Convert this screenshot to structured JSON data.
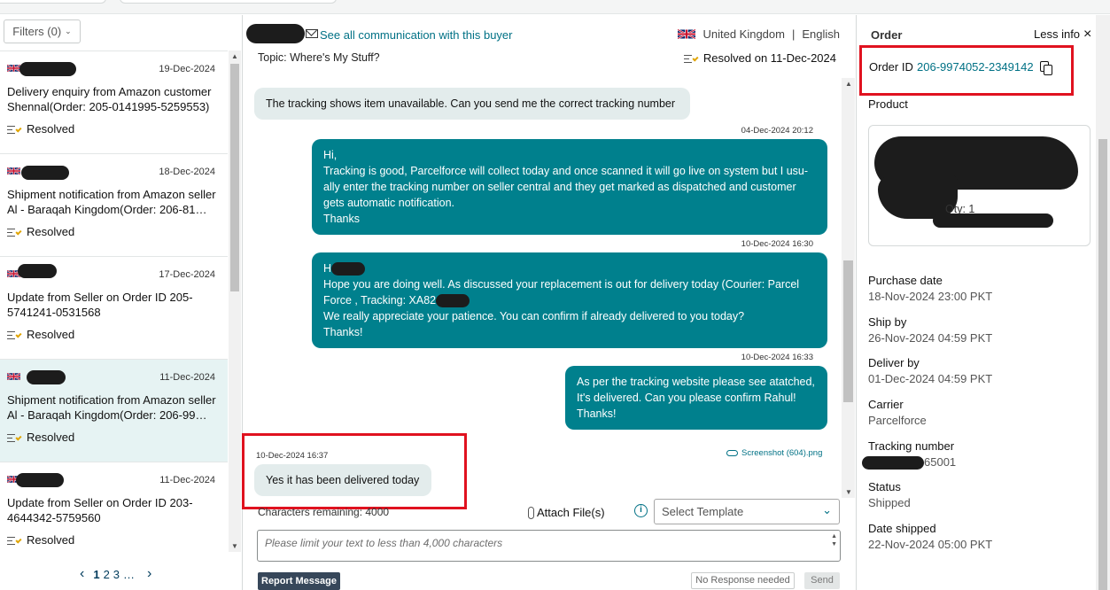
{
  "left": {
    "filters_label": "Filters (0)",
    "cases": [
      {
        "date": "19-Dec-2024",
        "subject": "Delivery enquiry from Amazon customer Shennal(Order: 205-0141995-5259553)",
        "status": "Resolved"
      },
      {
        "date": "18-Dec-2024",
        "subject": "Shipment notification from Amazon seller Al - Baraqah Kingdom(Order: 206-81…",
        "status": "Resolved"
      },
      {
        "date": "17-Dec-2024",
        "subject": "Update from Seller on Order ID 205-5741241-0531568",
        "status": "Resolved"
      },
      {
        "date": "11-Dec-2024",
        "subject": "Shipment notification from Amazon seller Al - Baraqah Kingdom(Order: 206-99…",
        "status": "Resolved"
      },
      {
        "date": "11-Dec-2024",
        "subject": "Update from Seller on Order ID 203-4644342-5759560",
        "status": "Resolved"
      }
    ],
    "pager": {
      "prev": "‹",
      "pages": [
        "1",
        "2",
        "3"
      ],
      "ellipsis": "…",
      "next": "›"
    }
  },
  "conversation": {
    "see_all": "See all communication with this buyer",
    "country": "United Kingdom",
    "separator": "|",
    "language": "English",
    "topic": "Topic: Where's My Stuff?",
    "resolved_on": "Resolved on 11-Dec-2024",
    "messages": [
      {
        "ts": "",
        "text": "The tracking shows item unavailable. Can you send me the correct tracking number"
      },
      {
        "ts": "04-Dec-2024 20:12",
        "lines": [
          "Hi,",
          "Tracking is good, Parcelforce will collect today and once scanned it will go live on system but I usu-",
          "ally enter the tracking number on seller central and they get marked as dispatched and customer",
          "gets automatic notification.",
          "Thanks"
        ]
      },
      {
        "ts": "10-Dec-2024 16:30",
        "lines": [
          "H",
          "Hope you are doing well. As discussed your replacement is out for delivery today  (Courier:  Parcel",
          "Force , Tracking: XA82",
          "We really appreciate your patience. You can confirm if already delivered to you today?",
          "Thanks!"
        ]
      },
      {
        "ts": "10-Dec-2024 16:33",
        "lines": [
          "As per the tracking website please see atatched,",
          "It's delivered. Can you please confirm Rahul!",
          "Thanks!"
        ]
      },
      {
        "ts": "10-Dec-2024 16:37",
        "text": "Yes it has been delivered today"
      }
    ],
    "attachment": "Screenshot (604).png",
    "chars_remaining": "Characters remaining: 4000",
    "attach_file": "Attach File(s)",
    "select_template": "Select Template",
    "placeholder": "Please limit your text to less than 4,000 characters",
    "report_message": "Report Message",
    "no_response": "No Response needed",
    "send": "Send"
  },
  "order": {
    "title": "Order",
    "less_info": "Less info",
    "order_id_label": "Order ID",
    "order_id": "206-9974052-2349142",
    "product_label": "Product",
    "qty": "Qty: 1",
    "fields": [
      {
        "label": "Purchase date",
        "value": "18-Nov-2024 23:00 PKT"
      },
      {
        "label": "Ship by",
        "value": "26-Nov-2024 04:59 PKT"
      },
      {
        "label": "Deliver by",
        "value": "01-Dec-2024 04:59 PKT"
      },
      {
        "label": "Carrier",
        "value": "Parcelforce"
      },
      {
        "label": "Tracking number",
        "value": "65001"
      },
      {
        "label": "Status",
        "value": "Shipped"
      },
      {
        "label": "Date shipped",
        "value": "22-Nov-2024 05:00 PKT"
      }
    ]
  },
  "colors": {
    "accent": "#007185",
    "outgoing_bubble": "#00808d",
    "incoming_bubble": "#e3ecec",
    "highlight_box": "#e0121f",
    "selected_row": "#e6f3f3"
  }
}
